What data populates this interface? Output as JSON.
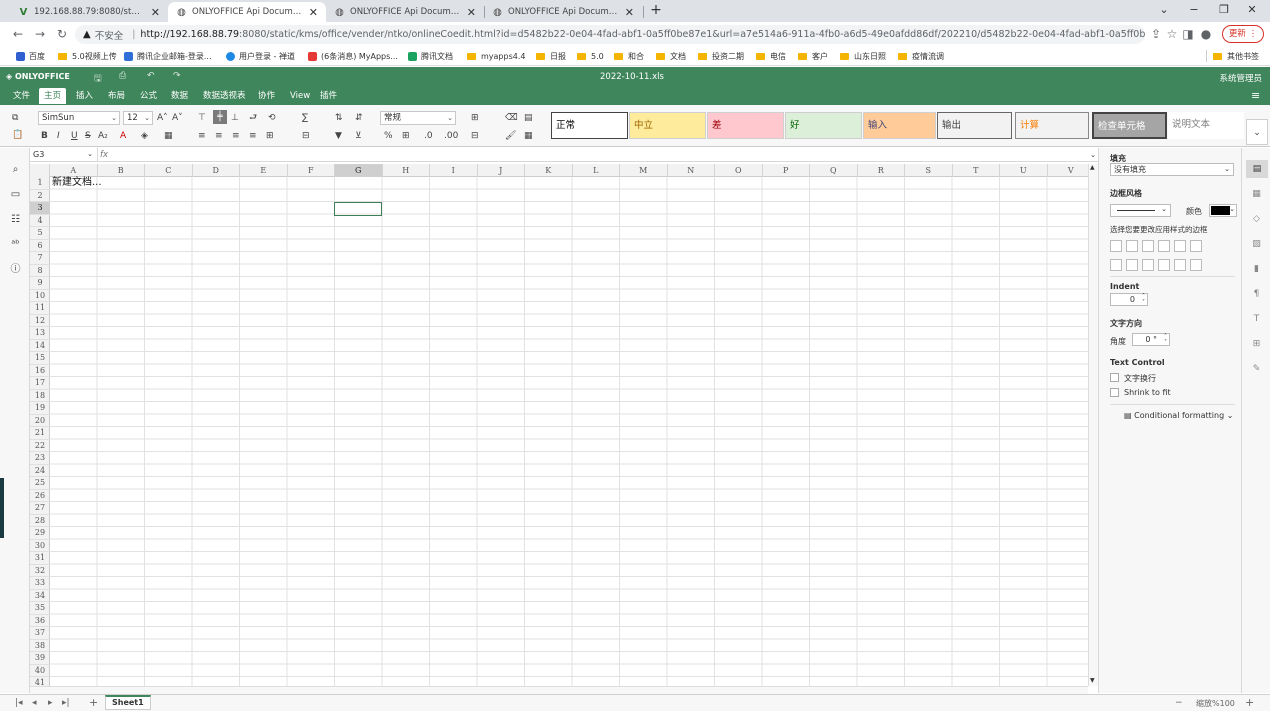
{
  "browser": {
    "tabs": [
      {
        "label": "192.168.88.79:8080/static/kms/",
        "icon": "v-logo-icon",
        "active": false
      },
      {
        "label": "ONLYOFFICE Api Documentati",
        "icon": "globe-icon",
        "active": true
      },
      {
        "label": "ONLYOFFICE Api Documentati",
        "icon": "globe-icon",
        "active": false
      },
      {
        "label": "ONLYOFFICE Api Documentati",
        "icon": "globe-icon",
        "active": false
      }
    ],
    "url": {
      "not_secure": "不安全",
      "host": "http://192.168.88.79",
      "rest": ":8080/static/kms/office/vender/ntko/onlineCoedit.html?id=d5482b22-0e04-4fad-abf1-0a5ff0be87e1&url=a7e514a6-911a-4fb0-a6d5-49e0afdd86df/202210/d5482b22-0e04-4fad-abf1-0a5ff0be87e1.xls..."
    },
    "update_label": "更新",
    "bookmarks": [
      "百度",
      "5.0视频上传",
      "腾讯企业邮箱-登录...",
      "用户登录 - 禅道",
      "(6条消息) MyApps...",
      "腾讯文档",
      "myapps4.4",
      "日报",
      "5.0",
      "和合",
      "文档",
      "投资二期",
      "电信",
      "客户",
      "山东日照",
      "疫情流调"
    ],
    "other_bookmarks": "其他书签"
  },
  "editor": {
    "logo": "ONLYOFFICE",
    "title": "2022-10-11.xls",
    "user": "系统管理员",
    "menu_tabs": [
      "文件",
      "主页",
      "插入",
      "布局",
      "公式",
      "数据",
      "数据透视表",
      "协作",
      "View",
      "插件"
    ],
    "active_tab": "主页",
    "font_name": "SimSun",
    "font_size": "12",
    "number_format": "常规",
    "cell_styles": [
      {
        "label": "正常",
        "bg": "#ffffff",
        "color": "#000000"
      },
      {
        "label": "中立",
        "bg": "#ffeb9c",
        "color": "#9c6500"
      },
      {
        "label": "差",
        "bg": "#ffc7ce",
        "color": "#9c0006"
      },
      {
        "label": "好",
        "bg": "#dcefd8",
        "color": "#006100"
      },
      {
        "label": "输入",
        "bg": "#ffcc99",
        "color": "#3f3f76"
      },
      {
        "label": "输出",
        "bg": "#f2f2f2",
        "color": "#3f3f3f"
      },
      {
        "label": "计算",
        "bg": "#f2f2f2",
        "color": "#fa7d00"
      },
      {
        "label": "检查单元格",
        "bg": "#a5a5a5",
        "color": "#ffffff"
      },
      {
        "label": "说明文本",
        "bg": "#ffffff",
        "color": "#7f7f7f"
      }
    ],
    "name_box": "G3",
    "fx": "fx",
    "columns": [
      "A",
      "B",
      "C",
      "D",
      "E",
      "F",
      "G",
      "H",
      "I",
      "J",
      "K",
      "L",
      "M",
      "N",
      "O",
      "P",
      "Q",
      "R",
      "S",
      "T",
      "U",
      "V"
    ],
    "selected_column": "G",
    "selected_row": 3,
    "rows": [
      1,
      2,
      3,
      4,
      5,
      6,
      7,
      8,
      9,
      10,
      11,
      12,
      13,
      14,
      15,
      16,
      17,
      18,
      19,
      20,
      21,
      22,
      23,
      24,
      25,
      26,
      27,
      28,
      29,
      30,
      31,
      32,
      33,
      34,
      35,
      36,
      37,
      38,
      39,
      40,
      41
    ],
    "cell_a1": "新建文档...",
    "sheet_tab": "Sheet1",
    "zoom_label": "缩放%100"
  },
  "panel": {
    "fill_label": "填充",
    "fill_value": "没有填充",
    "border_style_label": "边框风格",
    "color_label": "颜色",
    "border_hint": "选择您要更改应用样式的边框",
    "indent_label": "Indent",
    "indent_value": "0",
    "text_direction_label": "文字方向",
    "angle_label": "角度",
    "angle_value": "0 °",
    "text_control_label": "Text Control",
    "wrap_label": "文字换行",
    "shrink_label": "Shrink to fit",
    "cond_format_label": "Conditional formatting"
  }
}
